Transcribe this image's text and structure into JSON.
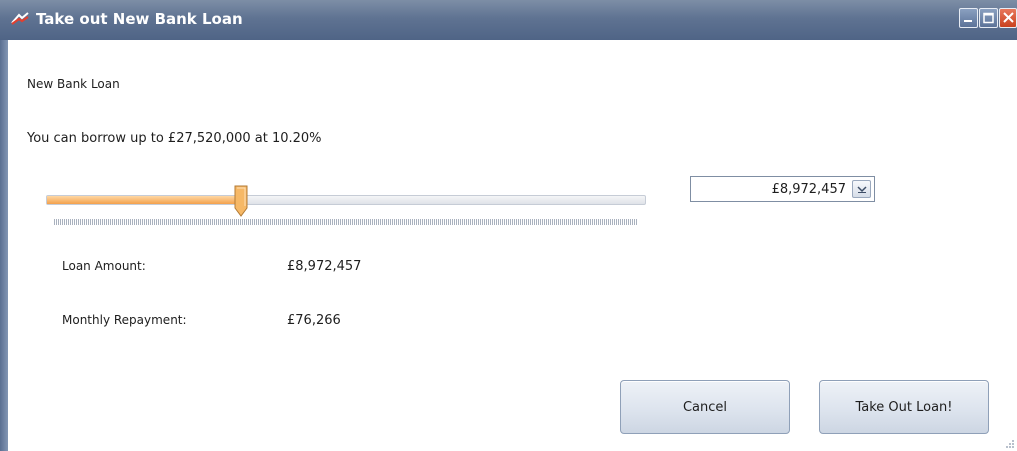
{
  "window": {
    "title": "Take out New Bank Loan",
    "app_icon": "bank-loan-icon",
    "controls": [
      "minimize-icon",
      "maximize-icon",
      "close-icon"
    ]
  },
  "main": {
    "heading": "New Bank Loan",
    "borrow_info": "You can borrow up to  £27,520,000 at 10.20%",
    "slider": {
      "min": 0,
      "max": 27520000,
      "value": 8972457,
      "fraction": 0.326
    },
    "amount_field": {
      "value": "£8,972,457",
      "dropdown_icon": "chevron-down-icon"
    },
    "loan_amount": {
      "label": "Loan Amount:",
      "value": "£8,972,457"
    },
    "monthly_repayment": {
      "label": "Monthly Repayment:",
      "value": "£76,266"
    }
  },
  "buttons": {
    "cancel": "Cancel",
    "take_out": "Take Out Loan!"
  },
  "colors": {
    "titlebar": "#5f7392",
    "slider_fill": "#f3a14c",
    "button_face": "#dde4ee",
    "close_button": "#d4512d"
  }
}
